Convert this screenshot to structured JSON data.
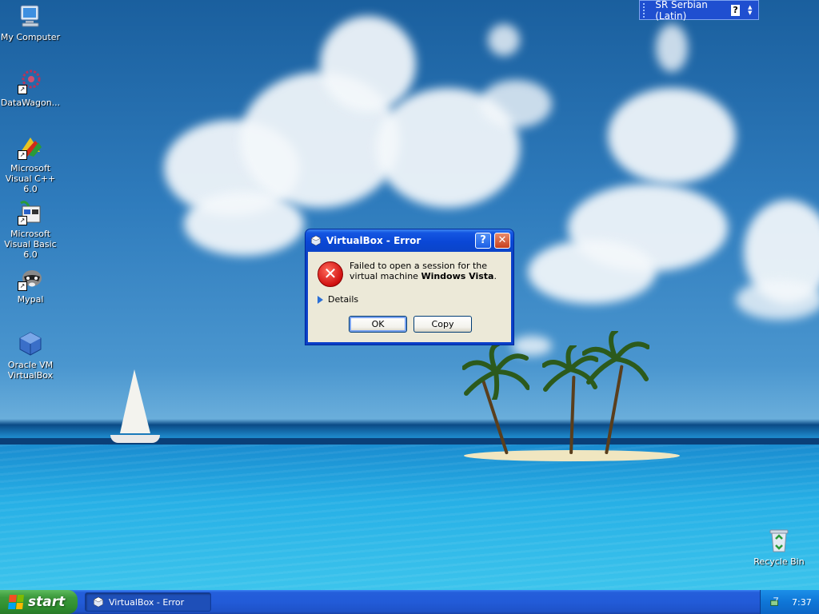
{
  "desktop": {
    "icons": [
      {
        "label": "My Computer"
      },
      {
        "label": "DataWagon..."
      },
      {
        "label": "Microsoft Visual C++ 6.0"
      },
      {
        "label": "Microsoft Visual Basic 6.0"
      },
      {
        "label": "Mypal"
      },
      {
        "label": "Oracle VM VirtualBox"
      },
      {
        "label": "Recycle Bin"
      }
    ]
  },
  "language_bar": {
    "language": "SR Serbian (Latin)",
    "help_glyph": "?"
  },
  "dialog": {
    "title": "VirtualBox - Error",
    "message_prefix": "Failed to open a session for the virtual machine ",
    "message_vm": "Windows Vista",
    "message_suffix": ".",
    "details_label": "Details",
    "ok_label": "OK",
    "copy_label": "Copy",
    "help_glyph": "?",
    "close_glyph": "✕"
  },
  "taskbar": {
    "start_label": "start",
    "tasks": [
      {
        "label": "VirtualBox - Error"
      }
    ],
    "clock": "7:37"
  },
  "colors": {
    "taskbar": "#245edb",
    "start_green": "#3c9a3c",
    "dialog_frame": "#0a47d6",
    "dialog_body": "#ece9d8",
    "error_red": "#d01010"
  }
}
